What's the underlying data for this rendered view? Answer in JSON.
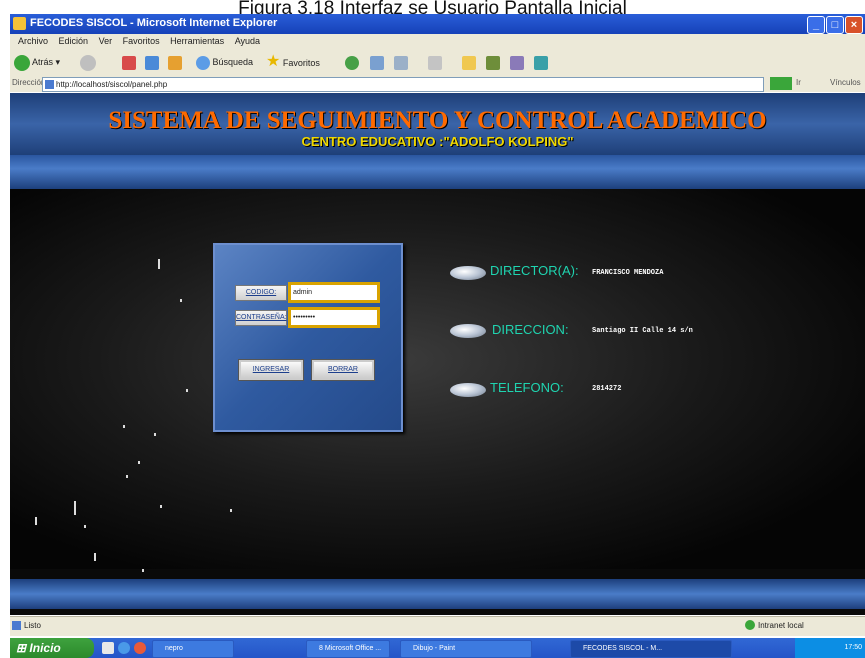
{
  "caption": "Figura 3.18 Interfaz se Usuario Pantalla Inicial",
  "window": {
    "title": "FECODES SISCOL - Microsoft Internet Explorer",
    "min": "_",
    "max": "□",
    "close": "×"
  },
  "menu": [
    "Archivo",
    "Edición",
    "Ver",
    "Favoritos",
    "Herramientas",
    "Ayuda"
  ],
  "toolbar": {
    "back": "Atrás",
    "search": "Búsqueda",
    "favorites": "Favoritos"
  },
  "address": {
    "label": "Dirección",
    "url": "http://localhost/siscol/panel.php",
    "go": "Ir",
    "links": "Vínculos"
  },
  "banner": {
    "title": "SISTEMA DE SEGUIMIENTO Y CONTROL ACADEMICO",
    "subtitle": "CENTRO EDUCATIVO :\"ADOLFO KOLPING\""
  },
  "login": {
    "code_label": "CODIGO:",
    "code_value": "admin",
    "password_label": "CONTRASEÑA:",
    "password_value": "•••••••••",
    "submit": "INGRESAR",
    "clear": "BORRAR"
  },
  "info": {
    "director_label": "DIRECTOR(A):",
    "director_value": "FRANCISCO MENDOZA",
    "address_label": "DIRECCION:",
    "address_value": "Santiago II Calle 14 s/n",
    "phone_label": "TELEFONO:",
    "phone_value": "2814272"
  },
  "status": {
    "left": "Listo",
    "right": "Intranet local"
  },
  "taskbar": {
    "start": "Inicio",
    "tasks": [
      "nepro",
      "8 Microsoft Office ...",
      "Dibujo - Paint",
      "FECODES SISCOL - M..."
    ],
    "clock": "17:50"
  },
  "colors": {
    "banner_title": "#ff6a00",
    "banner_subtitle": "#f0d800",
    "info_label": "#1fd4b0",
    "panel_blue": "#2f5aa0"
  }
}
